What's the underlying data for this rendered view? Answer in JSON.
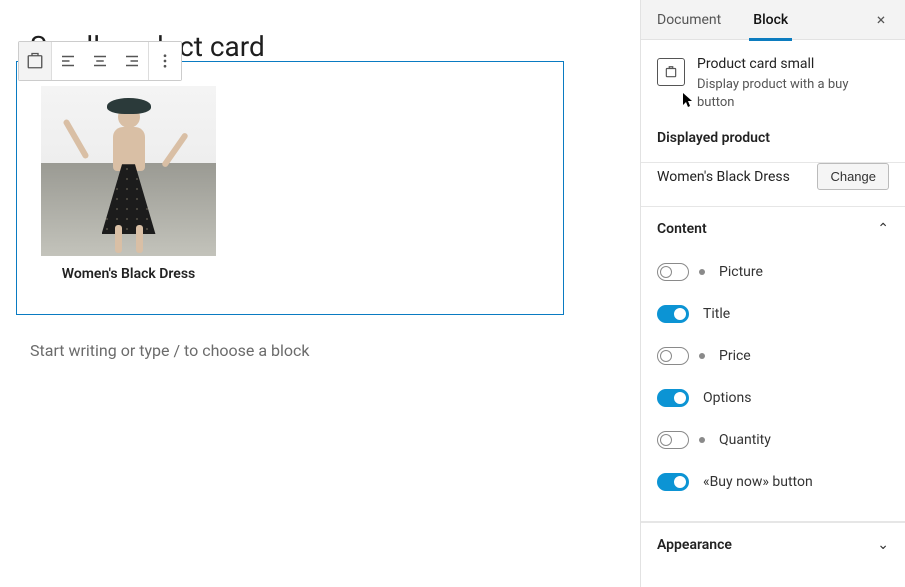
{
  "editor": {
    "page_title": "Small product card",
    "placeholder": "Start writing or type / to choose a block",
    "toolbar": {
      "block_type_icon": "product-card-icon",
      "align": [
        "align-left",
        "align-center",
        "align-right"
      ],
      "more": "more-icon"
    }
  },
  "card": {
    "product_title": "Women's Black Dress"
  },
  "sidebar": {
    "tabs": {
      "document": "Document",
      "block": "Block",
      "active": "block"
    },
    "close": "×",
    "block": {
      "name": "Product card small",
      "description": "Display product with a buy button"
    },
    "displayed_product": {
      "heading": "Displayed product",
      "name": "Women's Black Dress",
      "change_label": "Change"
    },
    "content": {
      "heading": "Content",
      "expanded": true,
      "items": [
        {
          "key": "picture",
          "label": "Picture",
          "on": false
        },
        {
          "key": "title",
          "label": "Title",
          "on": true
        },
        {
          "key": "price",
          "label": "Price",
          "on": false
        },
        {
          "key": "options",
          "label": "Options",
          "on": true
        },
        {
          "key": "quantity",
          "label": "Quantity",
          "on": false
        },
        {
          "key": "buy",
          "label": "«Buy now» button",
          "on": true
        }
      ]
    },
    "appearance": {
      "heading": "Appearance",
      "expanded": false
    }
  },
  "colors": {
    "accent": "#0c94d4",
    "selection": "#0a7bc2"
  }
}
